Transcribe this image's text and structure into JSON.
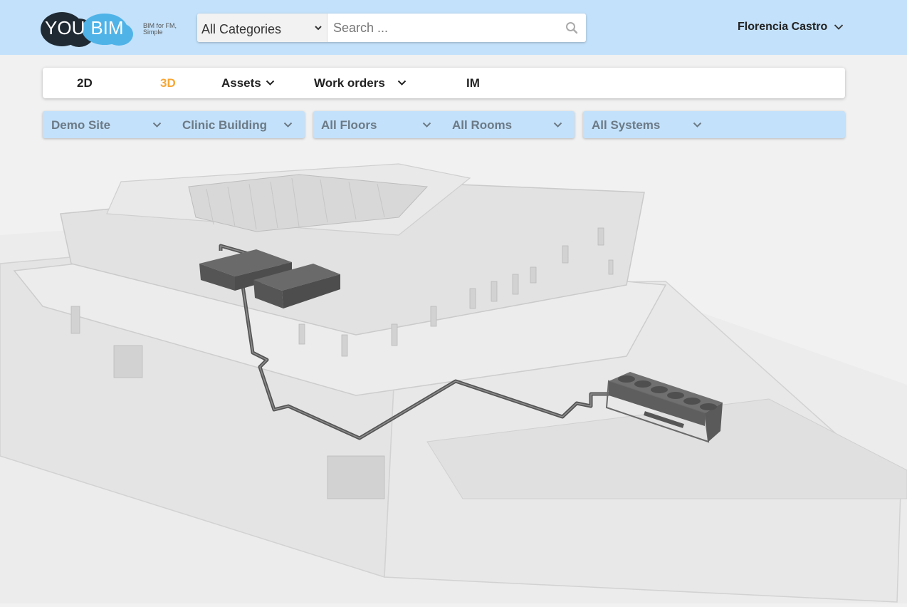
{
  "brand": {
    "logo_you": "YOU",
    "logo_bim": "BIM",
    "tagline_line1": "BIM for FM,",
    "tagline_line2": "Simple"
  },
  "search": {
    "category": "All Categories",
    "placeholder": "Search ..."
  },
  "user": {
    "name": "Florencia Castro"
  },
  "nav": {
    "items": [
      {
        "label": "2D"
      },
      {
        "label": "3D",
        "active": true
      },
      {
        "label": "Assets"
      },
      {
        "label": "Work orders"
      },
      {
        "label": "IM"
      }
    ]
  },
  "filters": {
    "site": "Demo Site",
    "building": "Clinic Building",
    "floors": "All Floors",
    "rooms": "All Rooms",
    "systems": "All Systems"
  },
  "colors": {
    "header_bg": "#c3e1fa",
    "accent_active": "#f7a735",
    "logo_dark": "#1f2a33",
    "logo_blue": "#4fb3e8"
  }
}
